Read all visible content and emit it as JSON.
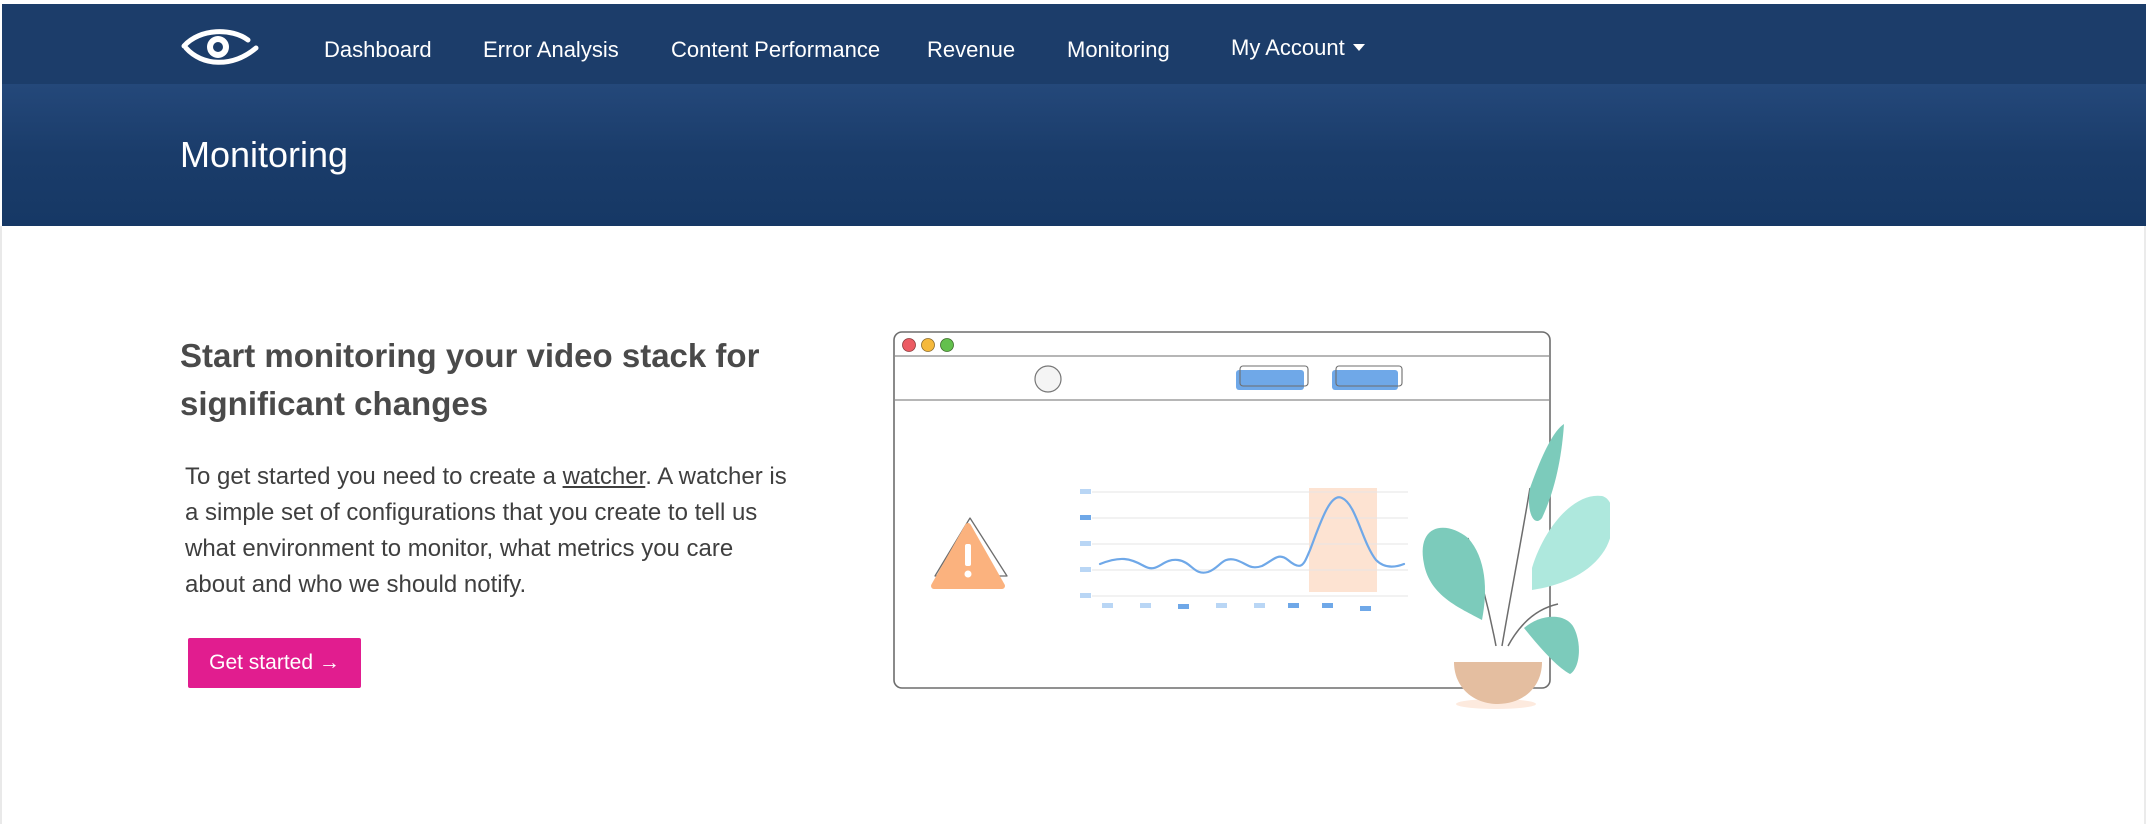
{
  "nav": {
    "items": [
      {
        "label": "Dashboard"
      },
      {
        "label": "Error Analysis"
      },
      {
        "label": "Content Performance"
      },
      {
        "label": "Revenue"
      },
      {
        "label": "Monitoring"
      }
    ],
    "account": {
      "label": "My Account"
    },
    "active": "Monitoring"
  },
  "header": {
    "title": "Monitoring"
  },
  "main": {
    "headline": "Start monitoring your video stack for significant changes",
    "description_before": "To get started you need to create a ",
    "description_link": "watcher",
    "description_after": ". A watcher is a simple set of configurations that you create to tell us what environment to monitor, what metrics you care about and who we should notify.",
    "cta_label": "Get started",
    "cta_arrow": "→"
  },
  "colors": {
    "nav_bg": "#1c3d6a",
    "cta": "#e11d8f",
    "active_underline": "#c9c16a"
  },
  "icons": {
    "logo": "eye-logo-icon",
    "dropdown": "caret-down-icon",
    "arrow": "arrow-right-icon",
    "warning": "warning-icon",
    "plant": "plant-icon"
  }
}
